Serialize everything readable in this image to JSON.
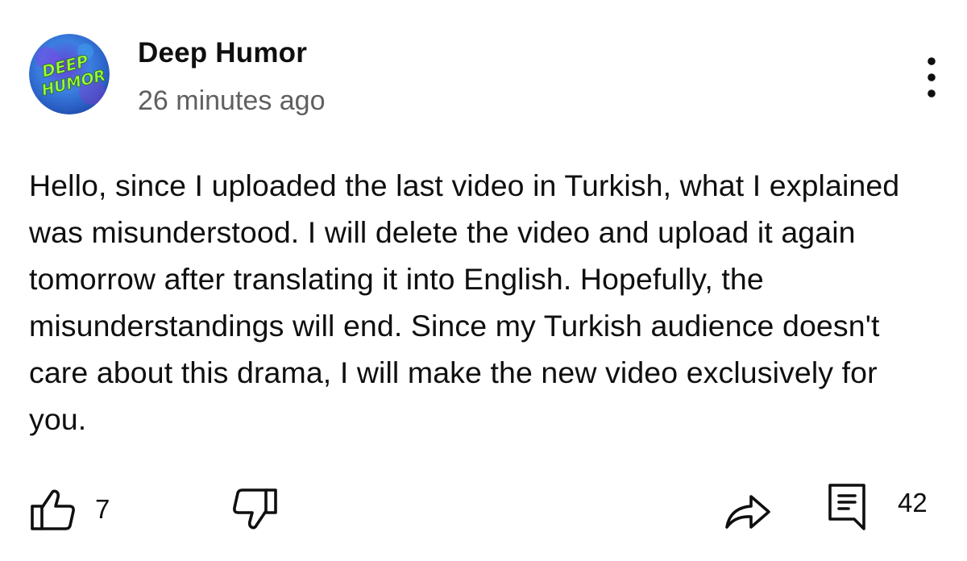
{
  "post": {
    "channel_name": "Deep Humor",
    "timestamp": "26 minutes ago",
    "body": "Hello, since I uploaded the last video in Turkish, what I explained was misunderstood. I will delete the video and upload it again tomorrow after translating it into English. Hopefully, the misunderstandings will end. Since my Turkish audience doesn't care about this drama, I will make the new video exclusively for you."
  },
  "avatar": {
    "logo_text_line1": "DEEP",
    "logo_text_line2": "HUMOR"
  },
  "actions": {
    "like_count": "7",
    "comment_count": "42"
  },
  "icons": {
    "avatar": "channel-avatar",
    "more": "more-vertical-icon",
    "like": "thumbs-up-icon",
    "dislike": "thumbs-down-icon",
    "share": "share-icon",
    "comment": "comment-icon"
  },
  "colors": {
    "text": "#0f0f0f",
    "secondary_text": "#606060",
    "logo_text": "#9cff3a"
  }
}
